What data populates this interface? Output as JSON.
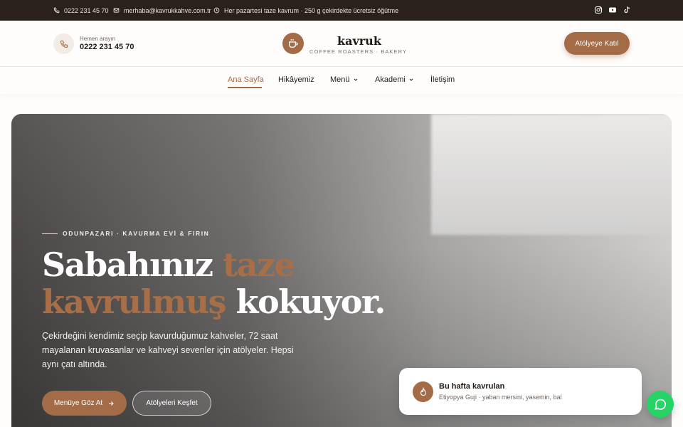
{
  "topbar": {
    "phone": "0222 231 45 70",
    "email": "merhaba@kavrukkahve.com.tr",
    "notice": "Her pazartesi taze kavrum · 250 g çekirdekte ücretsiz öğütme",
    "social_icons": [
      "instagram-icon",
      "youtube-icon",
      "tiktok-icon"
    ]
  },
  "header": {
    "call_label": "Hemen arayın",
    "call_number": "0222 231 45 70",
    "brand_name": "kavruk",
    "brand_tagline": "COFFEE ROASTERS · BAKERY",
    "cta_label": "Atölyeye Katıl"
  },
  "nav": {
    "items": [
      {
        "label": "Ana Sayfa",
        "active": true
      },
      {
        "label": "Hikâyemiz",
        "active": false
      },
      {
        "label": "Menü",
        "dropdown": true
      },
      {
        "label": "Akademi",
        "dropdown": true
      },
      {
        "label": "İletişim",
        "active": false
      }
    ]
  },
  "hero": {
    "eyebrow": "ODUNPAZARI · KAVURMA EVİ & FIRIN",
    "headline_part1": "Sabahınız ",
    "headline_accent1": "taze",
    "headline_accent2": "kavrulmuş",
    "headline_part2": " kokuyor.",
    "lead": "Çekirdeğini kendimiz seçip kavurduğumuz kahveler, 72 saat mayalanan kruvasanlar ve kahveyi sevenler için atölyeler. Hepsi aynı çatı altında.",
    "primary_button": "Menüye Göz At",
    "secondary_button": "Atölyeleri Keşfet"
  },
  "roast_card": {
    "title": "Bu hafta kavrulan",
    "subtitle": "Etiyopya Guji · yaban mersini, yasemin, bal"
  },
  "colors": {
    "accent": "#a46b47",
    "topbar_bg": "#2a211c",
    "whatsapp": "#25d366"
  }
}
